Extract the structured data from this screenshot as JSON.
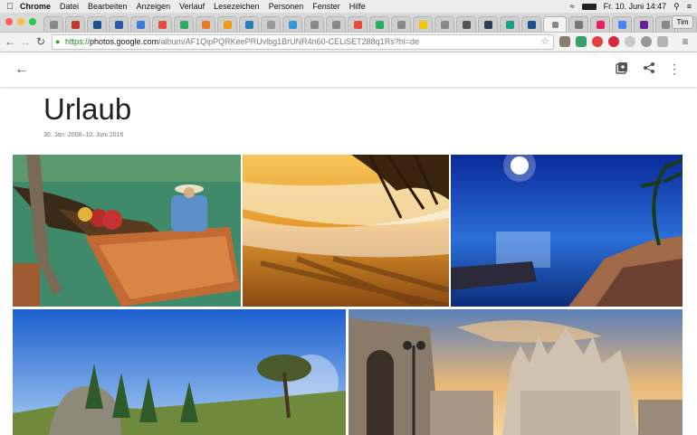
{
  "menubar": {
    "items": [
      "Chrome",
      "Datei",
      "Bearbeiten",
      "Anzeigen",
      "Verlauf",
      "Lesezeichen",
      "Personen",
      "Fenster",
      "Hilfe"
    ],
    "clock": "Fr. 10. Juni  14:47"
  },
  "browser": {
    "user_tab": "Tim",
    "url": {
      "scheme": "https://",
      "host": "photos.google.com",
      "path": "/album/AF1QipPQRKeePRUvlbg1BrUNR4n60-CELiSET288q1Rs?hl=de"
    }
  },
  "album": {
    "title": "Urlaub",
    "date_range": "30. Jan. 2008–10. Juni 2016"
  },
  "colors": {
    "chrome_red": "#fc605c",
    "chrome_yellow": "#fdbc40",
    "chrome_green": "#34c84a"
  },
  "icons": [
    "apple-icon",
    "back-arrow-icon",
    "add-to-album-icon",
    "share-icon",
    "more-vert-icon",
    "star-icon",
    "lock-icon"
  ]
}
